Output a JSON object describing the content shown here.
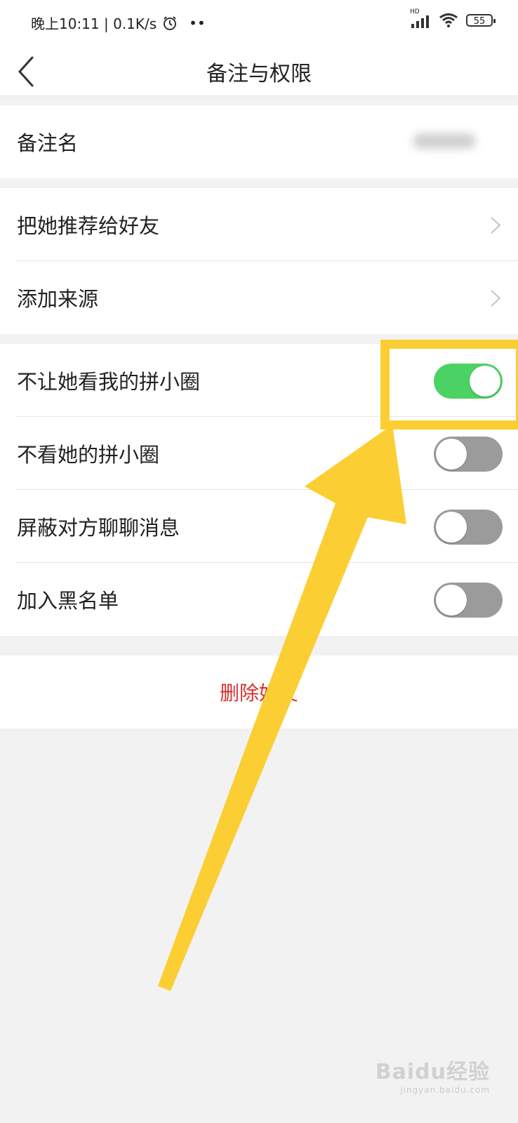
{
  "status": {
    "time_speed": "晚上10:11 | 0.1K/s",
    "alarm_icon": "alarm-clock-icon",
    "more": "••",
    "hd": "HD",
    "battery": "55"
  },
  "nav": {
    "title": "备注与权限",
    "back_icon": "chevron-left-icon"
  },
  "remark": {
    "label": "备注名"
  },
  "links": [
    {
      "label": "把她推荐给好友"
    },
    {
      "label": "添加来源"
    }
  ],
  "toggles": [
    {
      "label": "不让她看我的拼小圈",
      "on": true
    },
    {
      "label": "不看她的拼小圈",
      "on": false
    },
    {
      "label": "屏蔽对方聊聊消息",
      "on": false
    },
    {
      "label": "加入黑名单",
      "on": false
    }
  ],
  "delete_label": "删除好友",
  "annotation": {
    "color": "#fbcf33"
  },
  "colors": {
    "toggle_on": "#4cd264",
    "toggle_off": "#9b9b9b",
    "danger": "#d6312d"
  },
  "watermark": {
    "brand": "Baidu经验",
    "url": "jingyan.baidu.com"
  }
}
